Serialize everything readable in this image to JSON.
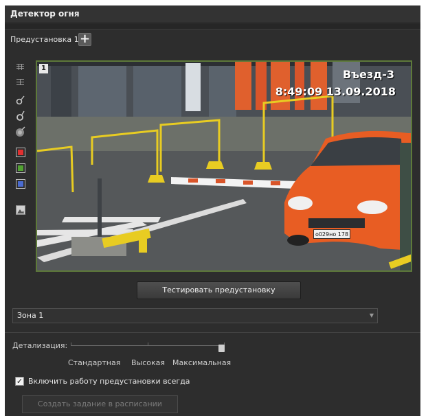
{
  "panel": {
    "title": "Детектор огня"
  },
  "preset": {
    "label": "Предустановка 1",
    "add_icon": "plus-icon"
  },
  "toolbar": {
    "tools": [
      {
        "name": "grid-small-icon"
      },
      {
        "name": "grid-large-icon"
      },
      {
        "name": "pencil-draw-icon"
      },
      {
        "name": "polygon-draw-icon"
      },
      {
        "name": "erase-icon"
      },
      {
        "name": "red-zone-icon",
        "color": "#e03030"
      },
      {
        "name": "green-zone-icon",
        "color": "#52a232"
      },
      {
        "name": "blue-zone-icon",
        "color": "#4a6bd0"
      },
      {
        "name": "image-icon"
      }
    ]
  },
  "video": {
    "camera_number": "1",
    "camera_name": "Въезд-3",
    "timestamp": "8:49:09  13.09.2018",
    "plate": "о029но 178",
    "zone_border_color": "#5e7a3a"
  },
  "actions": {
    "test_label": "Тестировать предустановку"
  },
  "zone": {
    "selected": "Зона 1"
  },
  "detail": {
    "label": "Детализация:",
    "levels": [
      "Стандартная",
      "Высокая",
      "Максимальная"
    ],
    "level_index": 2
  },
  "always_on": {
    "checked": true,
    "label": "Включить работу предустановки всегда"
  },
  "schedule": {
    "label": "Создать задание в расписании"
  }
}
